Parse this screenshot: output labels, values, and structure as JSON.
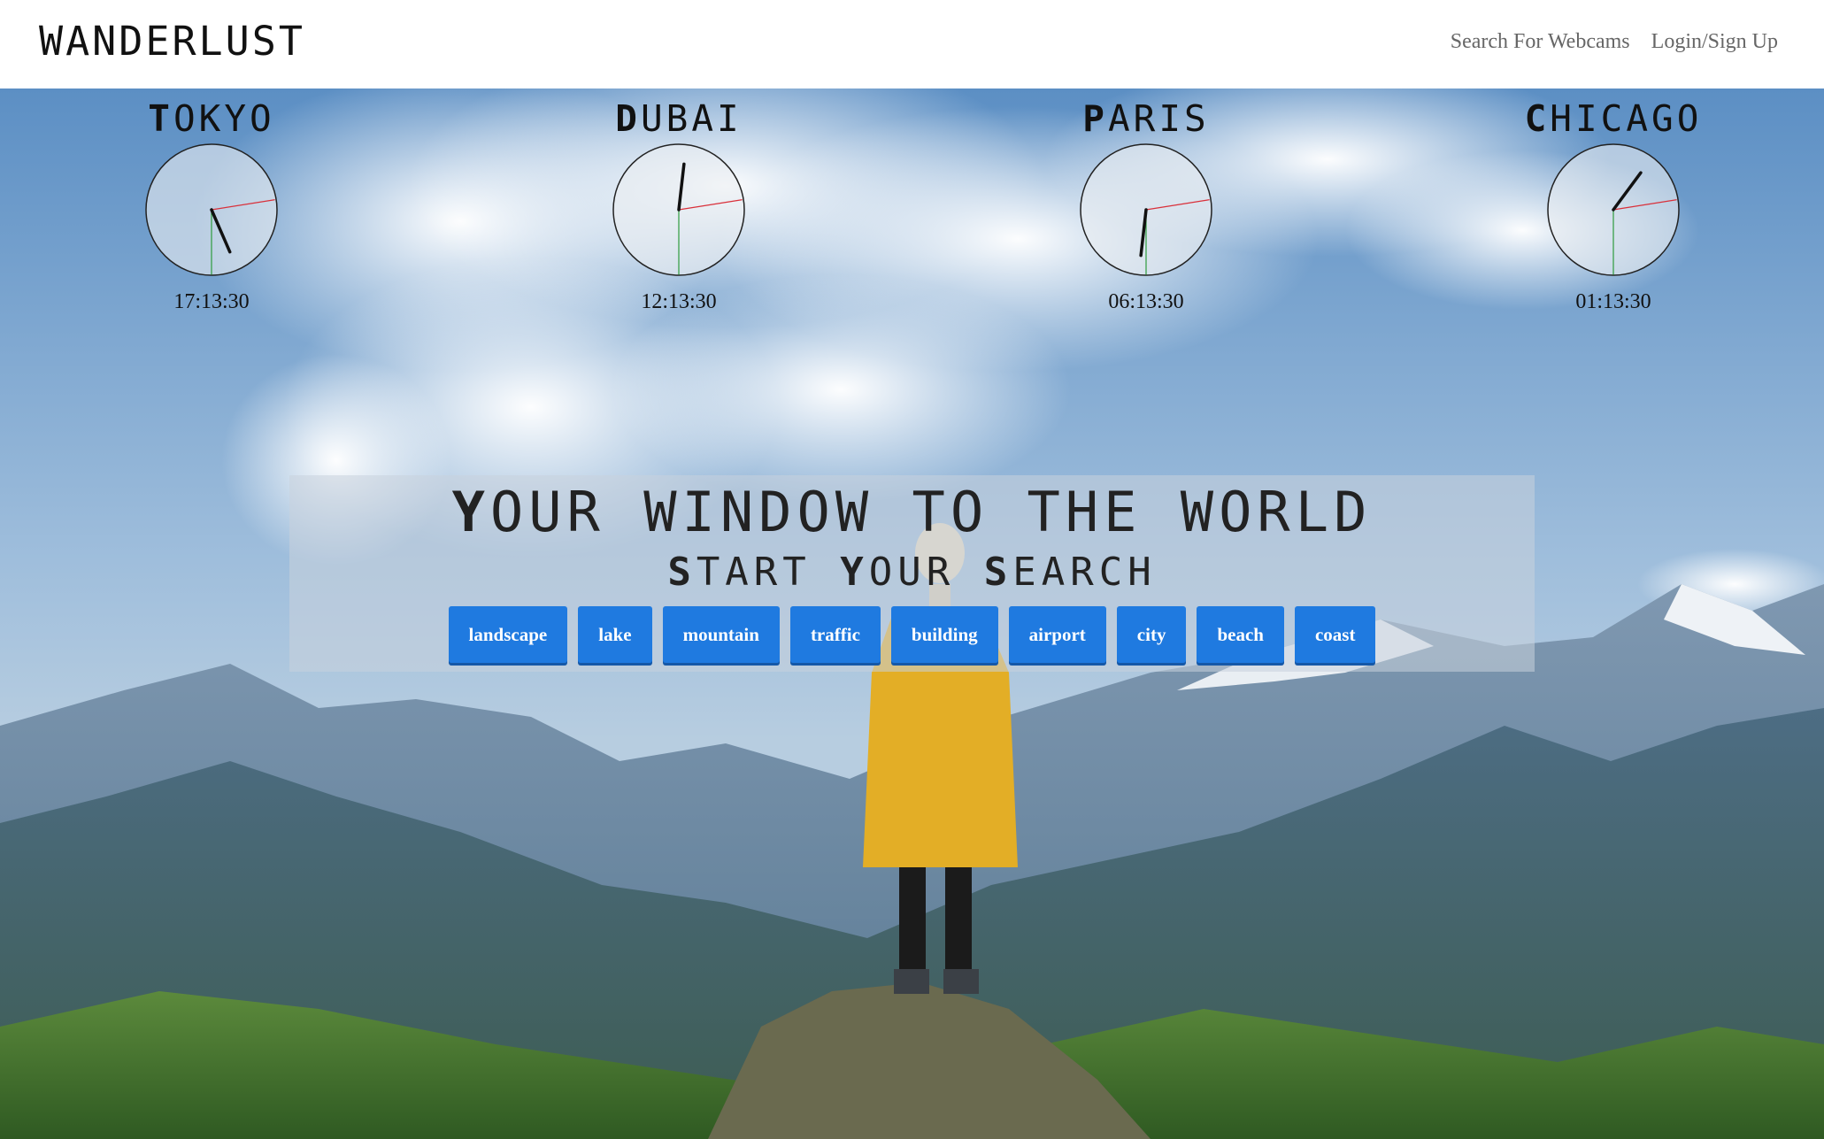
{
  "header": {
    "brand": "WANDERLUST",
    "nav": [
      {
        "label": "Search For Webcams"
      },
      {
        "label": "Login/Sign Up"
      }
    ]
  },
  "clocks": [
    {
      "first": "T",
      "rest": "OKYO",
      "time": "17:13:30",
      "hour": 17,
      "minute": 13,
      "second": 30
    },
    {
      "first": "D",
      "rest": "UBAI",
      "time": "12:13:30",
      "hour": 12,
      "minute": 13,
      "second": 30
    },
    {
      "first": "P",
      "rest": "ARIS",
      "time": "06:13:30",
      "hour": 6,
      "minute": 13,
      "second": 30
    },
    {
      "first": "C",
      "rest": "HICAGO",
      "time": "01:13:30",
      "hour": 1,
      "minute": 13,
      "second": 30
    }
  ],
  "hero": {
    "title_first": "Y",
    "title_rest": "OUR WINDOW TO THE WORLD",
    "subtitle": [
      {
        "first": "S",
        "rest": "TART "
      },
      {
        "first": "Y",
        "rest": "OUR "
      },
      {
        "first": "S",
        "rest": "EARCH"
      }
    ],
    "tags": [
      "landscape",
      "lake",
      "mountain",
      "traffic",
      "building",
      "airport",
      "city",
      "beach",
      "coast"
    ]
  },
  "colors": {
    "tag_bg": "#1f7ae0",
    "second_hand": "#d9303a",
    "third_hand": "#2e9b3e"
  }
}
